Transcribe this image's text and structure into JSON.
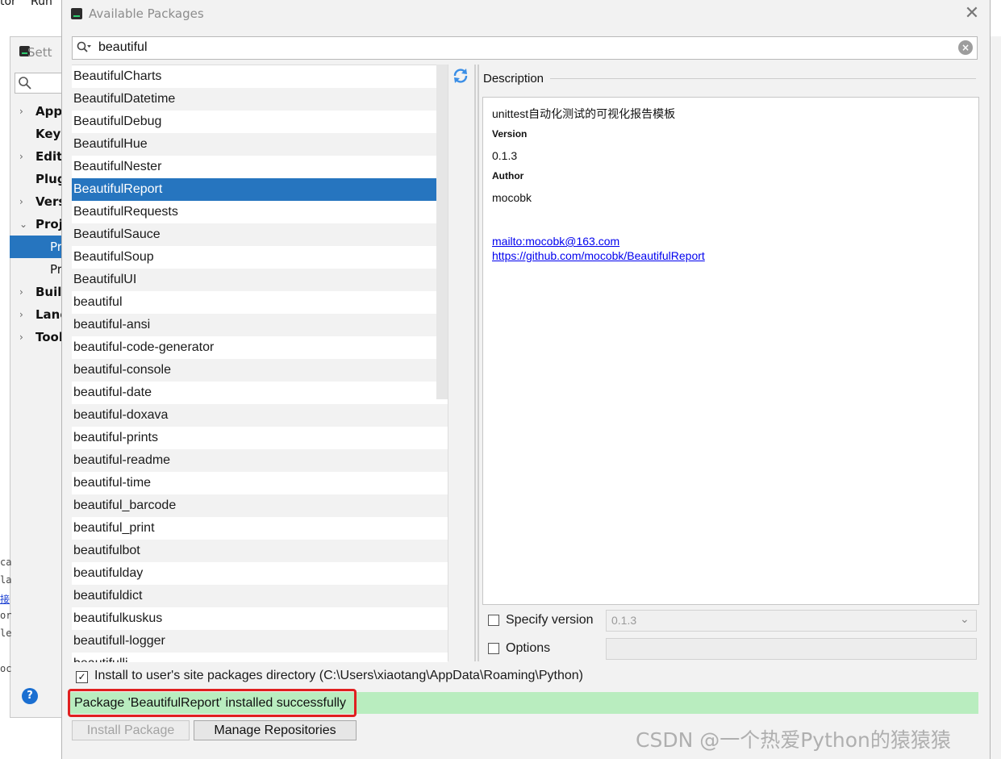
{
  "background": {
    "menubar": [
      "tor",
      "Run"
    ],
    "settings_title": "Sett",
    "settings_tree": [
      {
        "label": "App",
        "arrow": "›"
      },
      {
        "label": "Keyr",
        "arrow": ""
      },
      {
        "label": "Edito",
        "arrow": "›"
      },
      {
        "label": "Plug",
        "arrow": ""
      },
      {
        "label": "Vers",
        "arrow": "›"
      },
      {
        "label": "Proj",
        "arrow": "⌄"
      },
      {
        "label": "Pr",
        "arrow": ""
      },
      {
        "label": "Pr",
        "arrow": ""
      },
      {
        "label": "Build",
        "arrow": "›"
      },
      {
        "label": "Lang",
        "arrow": "›"
      },
      {
        "label": "Tool",
        "arrow": "›"
      }
    ],
    "code_fragments": [
      "ca",
      "la",
      "接",
      "or",
      "le",
      "oc"
    ],
    "help_label": "?"
  },
  "dialog": {
    "title": "Available Packages",
    "close_label": "✕"
  },
  "search": {
    "value": "beautiful"
  },
  "packages": [
    "BeautifulCharts",
    "BeautifulDatetime",
    "BeautifulDebug",
    "BeautifulHue",
    "BeautifulNester",
    "BeautifulReport",
    "BeautifulRequests",
    "BeautifulSauce",
    "BeautifulSoup",
    "BeautifulUI",
    "beautiful",
    "beautiful-ansi",
    "beautiful-code-generator",
    "beautiful-console",
    "beautiful-date",
    "beautiful-doxava",
    "beautiful-prints",
    "beautiful-readme",
    "beautiful-time",
    "beautiful_barcode",
    "beautiful_print",
    "beautifulbot",
    "beautifulday",
    "beautifuldict",
    "beautifulkuskus",
    "beautifull-logger",
    "beautifulli..."
  ],
  "selected_package": "BeautifulReport",
  "description": {
    "label": "Description",
    "summary": "unittest自动化测试的可视化报告模板",
    "version_heading": "Version",
    "version": "0.1.3",
    "author_heading": "Author",
    "author": "mocobk",
    "link_email": "mailto:mocobk@163.com",
    "link_repo": "https://github.com/mocobk/BeautifulReport"
  },
  "options": {
    "specify_version_label": "Specify version",
    "specify_version_checked": false,
    "version_value": "0.1.3",
    "options_label": "Options",
    "options_checked": false,
    "install_user_label": "Install to user's site packages directory (C:\\Users\\xiaotang\\AppData\\Roaming\\Python)",
    "install_user_checked": true,
    "install_user_mark": "✓"
  },
  "status": {
    "message": "Package 'BeautifulReport' installed successfully"
  },
  "buttons": {
    "install": "Install Package",
    "manage": "Manage Repositories"
  },
  "watermark": "CSDN @一个热爱Python的猿猿猿",
  "colors": {
    "selection": "#2675bf",
    "status_bg": "#b9edbf",
    "highlight_border": "#e02020",
    "link": "#0000ee"
  }
}
